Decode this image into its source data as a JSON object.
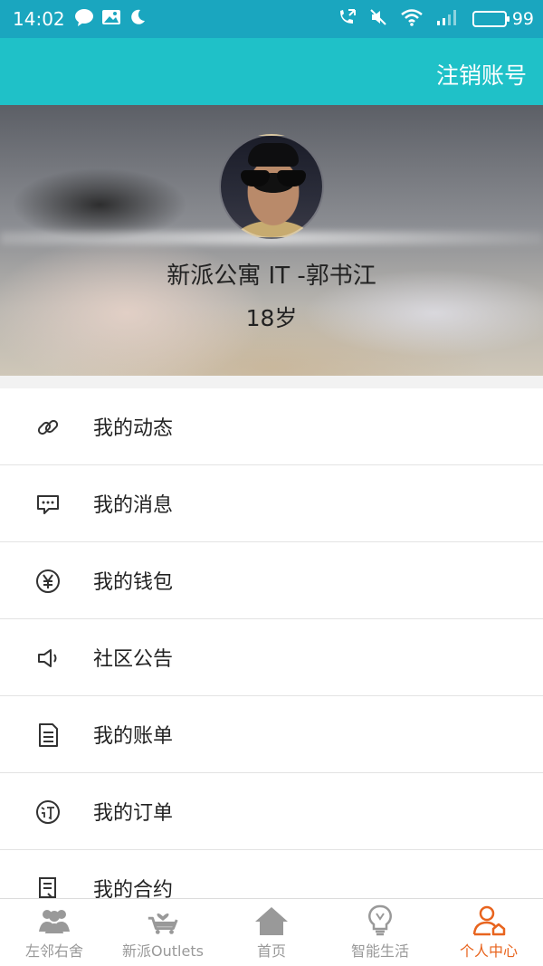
{
  "statusbar": {
    "time": "14:02",
    "battery": "99",
    "battery_level": 0.99
  },
  "appbar": {
    "logout_label": "注销账号"
  },
  "profile": {
    "name": "新派公寓 IT -郭书江",
    "age": "18岁"
  },
  "menu": {
    "items": [
      {
        "label": "我的动态",
        "icon": "link-icon"
      },
      {
        "label": "我的消息",
        "icon": "message-icon"
      },
      {
        "label": "我的钱包",
        "icon": "yen-icon"
      },
      {
        "label": "社区公告",
        "icon": "speaker-icon"
      },
      {
        "label": "我的账单",
        "icon": "bill-icon"
      },
      {
        "label": "我的订单",
        "icon": "order-icon"
      },
      {
        "label": "我的合约",
        "icon": "contract-icon"
      }
    ]
  },
  "tabbar": {
    "tabs": [
      {
        "label": "左邻右舍",
        "icon": "neighbors-icon"
      },
      {
        "label": "新派Outlets",
        "icon": "cart-icon"
      },
      {
        "label": "首页",
        "icon": "home-icon"
      },
      {
        "label": "智能生活",
        "icon": "bulb-icon"
      },
      {
        "label": "个人中心",
        "icon": "profile-icon"
      }
    ],
    "active_index": 4
  },
  "colors": {
    "statusbar": "#1aa6bf",
    "appbar": "#1fc1c8",
    "active_tab": "#e8641e",
    "inactive_tab": "#999999"
  }
}
